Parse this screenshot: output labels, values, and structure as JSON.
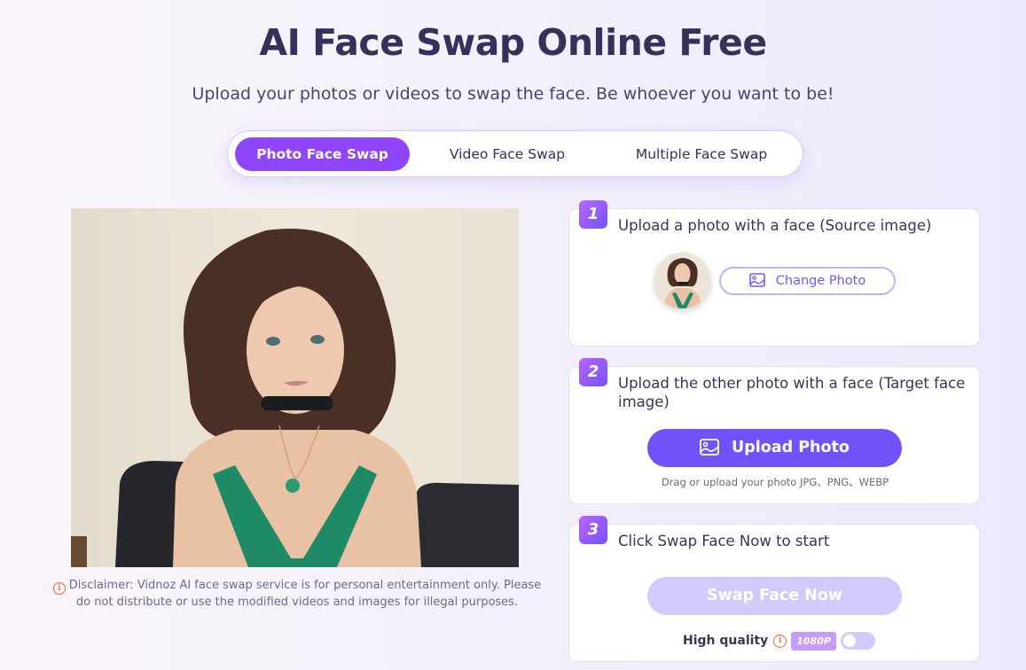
{
  "header": {
    "title": "AI Face Swap Online Free",
    "subtitle": "Upload your photos or videos to swap the face. Be whoever you want to be!"
  },
  "tabs": [
    {
      "label": "Photo Face Swap",
      "active": true
    },
    {
      "label": "Video Face Swap",
      "active": false
    },
    {
      "label": "Multiple Face Swap",
      "active": false
    }
  ],
  "preview": {
    "icon": "person-photo-image"
  },
  "disclaimer": {
    "icon": "info-icon",
    "text": "Disclaimer: Vidnoz AI face swap service is for personal entertainment only. Please do not distribute or use the modified videos and images for illegal purposes."
  },
  "steps": [
    {
      "number": "1",
      "heading": "Upload a photo with a face (Source image)",
      "button_label": "Change Photo",
      "button_icon": "image-icon"
    },
    {
      "number": "2",
      "heading": "Upload the other photo with a face (Target face image)",
      "button_label": "Upload Photo",
      "button_icon": "image-icon",
      "hint": "Drag or upload your photo JPG、PNG、WEBP"
    },
    {
      "number": "3",
      "heading": "Click Swap Face Now to start",
      "button_label": "Swap Face Now",
      "quality_label": "High quality",
      "quality_badge": "1080P",
      "quality_enabled": false
    }
  ],
  "colors": {
    "accent": "#8f45fb",
    "primary_button": "#7252fb",
    "disabled_button": "#d3c9fb",
    "warning": "#ef6a3c",
    "title": "#36305a"
  }
}
